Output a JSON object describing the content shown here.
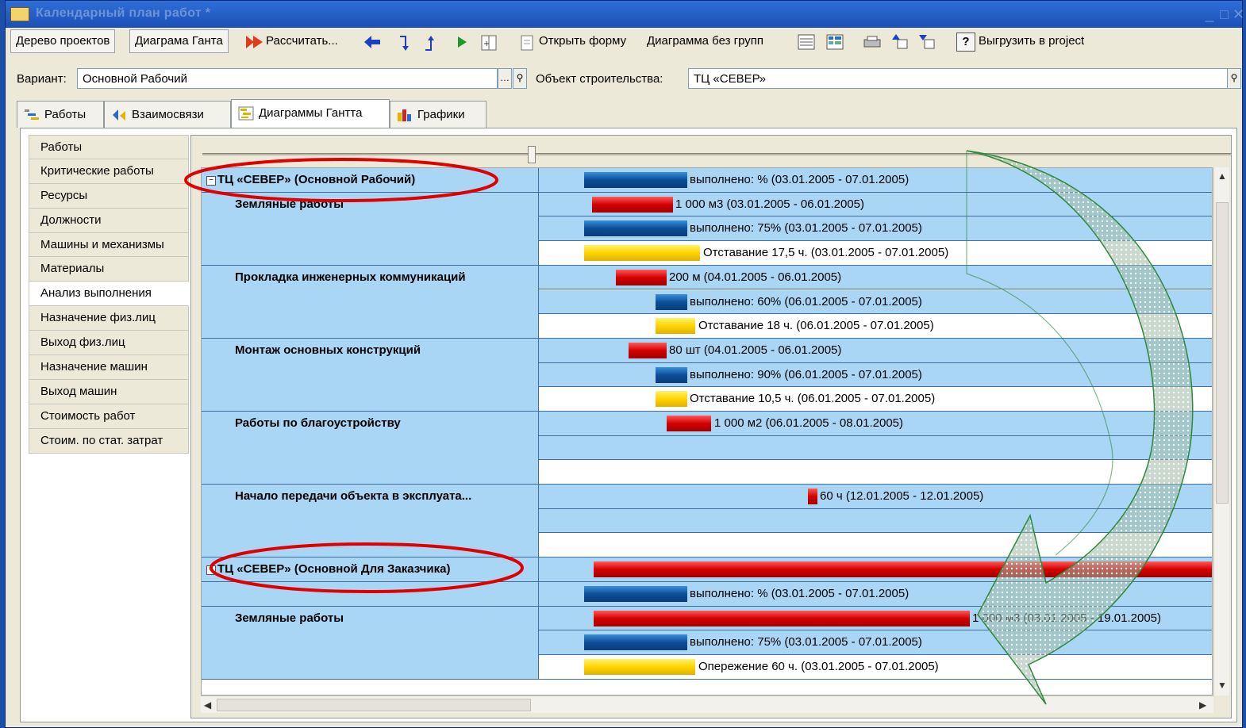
{
  "window": {
    "title": "Календарный план работ *"
  },
  "toolbar": {
    "tree_label": "Дерево проектов",
    "gantt_label": "Диаграма Ганта",
    "calculate_label": "Рассчитать...",
    "open_form_label": "Открыть форму",
    "no_groups_label": "Диаграмма без групп",
    "help_label": "?",
    "export_label": "Выгрузить в project"
  },
  "filters": {
    "variant_label": "Вариант:",
    "variant_value": "Основной Рабочий",
    "object_label": "Объект строительства:",
    "object_value": "ТЦ «СЕВЕР»"
  },
  "tabs": [
    {
      "label": "Работы"
    },
    {
      "label": "Взаимосвязи"
    },
    {
      "label": "Диаграммы Гантта"
    },
    {
      "label": "Графики"
    }
  ],
  "sidebar": {
    "items": [
      "Работы",
      "Критические работы",
      "Ресурсы",
      "Должности",
      "Машины и механизмы",
      "Материалы",
      "Анализ выполнения",
      "Назначение физ.лиц",
      "Выход физ.лиц",
      "Назначение машин",
      "Выход машин",
      "Стоимость работ",
      "Стоим. по стат. затрат"
    ]
  },
  "gantt": {
    "groups": [
      {
        "name": "ТЦ «СЕВЕР» (Основной Рабочий)",
        "root": true
      },
      {
        "name": "Земляные работы"
      },
      {
        "name": "Прокладка инженерных коммуникаций"
      },
      {
        "name": "Монтаж основных конструкций"
      },
      {
        "name": "Работы по благоустройству"
      },
      {
        "name": "Начало передачи объекта в эксплуата..."
      },
      {
        "name": "ТЦ «СЕВЕР» (Основной Для Заказчика)",
        "root": true
      },
      {
        "name": "Земляные работы"
      }
    ],
    "bar_labels": [
      "выполнено: % (03.01.2005 - 07.01.2005)",
      "1 000 м3 (03.01.2005 - 06.01.2005)",
      "выполнено: 75% (03.01.2005 - 07.01.2005)",
      "Отставание 17,5 ч. (03.01.2005 - 07.01.2005)",
      "200 м (04.01.2005 - 06.01.2005)",
      "выполнено: 60% (06.01.2005 - 07.01.2005)",
      "Отставание 18 ч. (06.01.2005 - 07.01.2005)",
      "80 шт (04.01.2005 - 06.01.2005)",
      "выполнено: 90% (06.01.2005 - 07.01.2005)",
      "Отставание 10,5 ч. (06.01.2005 - 07.01.2005)",
      "1 000 м2 (06.01.2005 - 08.01.2005)",
      "60 ч (12.01.2005 - 12.01.2005)",
      "выполнено: % (03.01.2005 - 07.01.2005)",
      "1 000 м3 (03.01.2005 - 19.01.2005)",
      "выполнено: 75% (03.01.2005 - 07.01.2005)",
      "Опережение 60 ч. (03.01.2005 - 07.01.2005)"
    ]
  },
  "colors": {
    "row_blue": "#a9d6f5",
    "bar_red": "#d40000",
    "bar_blue": "#0b4f98",
    "bar_yellow": "#ffd400",
    "highlight_ellipse": "#e00000",
    "arrow_fill": "#3c8a3c"
  }
}
